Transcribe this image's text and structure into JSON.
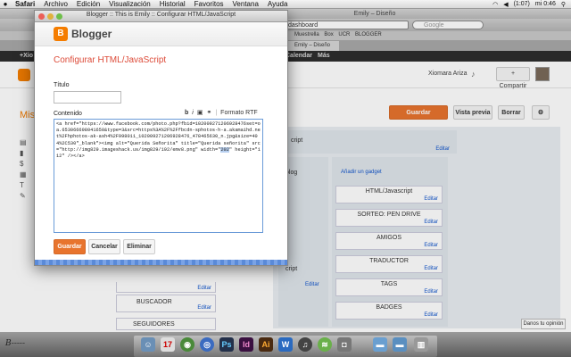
{
  "menubar": {
    "app": "Safari",
    "items": [
      "Archivo",
      "Edición",
      "Visualización",
      "Historial",
      "Favoritos",
      "Ventana",
      "Ayuda"
    ],
    "battery": "(1:07)",
    "clock": "mi 0:46"
  },
  "browser": {
    "window_title": "Emily – Diseño",
    "url": "dashboard",
    "search_placeholder": "Google",
    "bookmarks": [
      "Muestrella",
      "Box",
      "UCR",
      "BLOGGER"
    ],
    "tab_title": "Emily – Diseño",
    "gbar_items": [
      "+Xio",
      "Calendar",
      "Más"
    ],
    "user_name": "Xiomara Ariza",
    "share_label": "+ Compartir",
    "side_title": "Mis",
    "btn_save_layout": "Guardar disposición",
    "btn_preview": "Vista previa",
    "btn_delete": "Borrar",
    "add_gadget": "Añadir un gadget",
    "edit_label": "Editar",
    "gadgets": [
      "HTML/Javascript",
      "SORTEO: PEN DRIVE",
      "AMIGOS",
      "TRADUCTOR",
      "TAGS",
      "BADGES"
    ],
    "bottom_gadgets": [
      "BUSCADOR",
      "SEGUIDORES"
    ],
    "feedback": "Danos tu opinión",
    "behind_fragments": [
      "cript",
      "olog",
      "cript"
    ]
  },
  "popup": {
    "window_title": "Blogger :: This is Emily :: Configurar HTML/JavaScript",
    "logo_text": "Blogger",
    "heading": "Configurar HTML/JavaScript",
    "title_label": "Título",
    "title_value": "",
    "content_label": "Contenido",
    "tool_bold": "b",
    "tool_italic": "i",
    "tool_rich": "Formato RTF",
    "content_before": "<a href=\"https://www.facebook.com/photo.php?fbid=102009271206928476set=oa.653066698041650&type=3&src=https%3A%2F%2Ffbcdn-sphotos-h-a.akamaihd.net%2Fhphotos-ak-ash4%2F998011_102009271206928476_478465630_n.jpg&size=404%2C530\"_blank\"><img alt=\"Querida Señorita\" title=\"Querida señorita\" src=\"http://img829.imageshack.us/img829/192/emv8.png\" width=\"",
    "content_highlight": "202",
    "content_after": "\" height=\"112\" /></a>",
    "btn_save": "Guardar",
    "btn_cancel": "Cancelar",
    "btn_remove": "Eliminar"
  },
  "signature": "B-----"
}
